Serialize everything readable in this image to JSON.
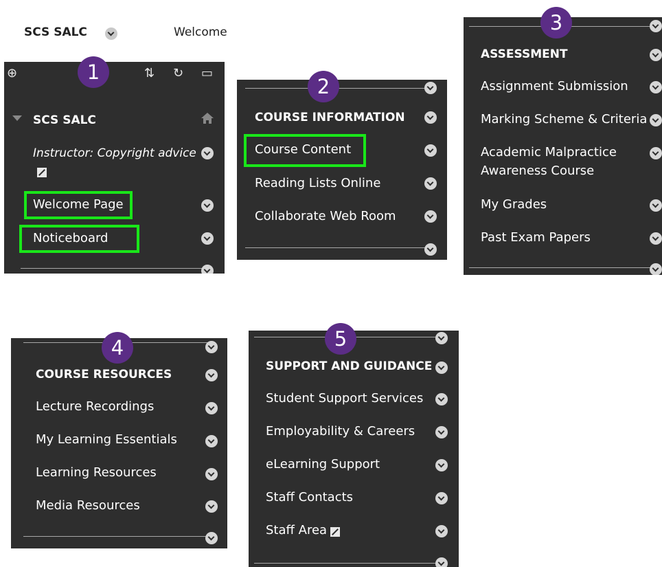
{
  "topbar": {
    "course_name": "SCS SALC",
    "welcome_partial": "Welcome"
  },
  "panel1": {
    "badge": "1",
    "course_label": "SCS SALC",
    "instructor_link": "Instructor: Copyright advice",
    "items": [
      "Welcome Page",
      "Noticeboard"
    ]
  },
  "panel2": {
    "badge": "2",
    "heading": "COURSE INFORMATION",
    "items": [
      "Course Content",
      "Reading Lists Online",
      "Collaborate Web Room"
    ]
  },
  "panel3": {
    "badge": "3",
    "heading": "ASSESSMENT",
    "items": [
      "Assignment Submission",
      "Marking Scheme & Criteria",
      "Academic Malpractice",
      "Awareness Course",
      "My Grades",
      "Past Exam Papers"
    ]
  },
  "panel4": {
    "badge": "4",
    "heading": "COURSE RESOURCES",
    "items": [
      "Lecture Recordings",
      "My Learning Essentials",
      "Learning Resources",
      "Media Resources"
    ]
  },
  "panel5": {
    "badge": "5",
    "heading": "SUPPORT AND GUIDANCE",
    "items": [
      "Student Support Services",
      "Employability & Careers",
      "eLearning Support",
      "Staff Contacts",
      "Staff Area"
    ]
  },
  "colors": {
    "panel_bg": "#2e2e2e",
    "badge_purple": "#5b2d86",
    "highlight_green": "#19e619",
    "text": "#ffffff"
  }
}
